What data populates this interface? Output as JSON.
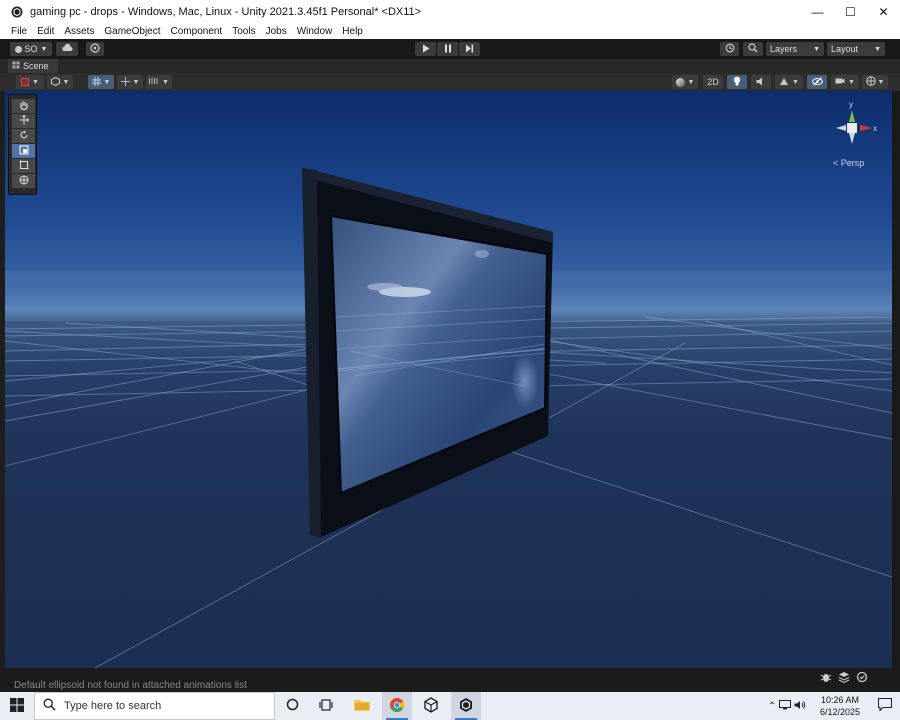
{
  "window": {
    "title": "gaming pc - drops - Windows, Mac, Linux - Unity 2021.3.45f1 Personal* <DX11>",
    "minimize": "—",
    "maximize": "☐",
    "close": "✕"
  },
  "menu": [
    "File",
    "Edit",
    "Assets",
    "GameObject",
    "Component",
    "Tools",
    "Jobs",
    "Window",
    "Help"
  ],
  "toolbar": {
    "account_label": "SO",
    "layers_label": "Layers",
    "layout_label": "Layout"
  },
  "scene_tab": {
    "label": "Scene"
  },
  "scene_toolbar": {
    "mode_2d_label": "2D"
  },
  "gizmo": {
    "y_label": "y",
    "x_label": "x",
    "projection_label": "Persp"
  },
  "status": {
    "message": "Default ellipsoid not found in attached animations list"
  },
  "taskbar": {
    "search_placeholder": "Type here to search",
    "time": "10:26 AM",
    "date": "6/12/2025"
  },
  "colors": {
    "sky_top": "#0d2d6e",
    "horizon": "#5a82b6",
    "ground": "#1c2f52",
    "frame": "#0b0f18",
    "gizmo_x": "#d23a2e",
    "gizmo_y": "#78c23a",
    "accent": "#5274a8"
  },
  "icons": {
    "app": "unity-logo-icon",
    "tools": [
      "hand-tool-icon",
      "move-tool-icon",
      "rotate-tool-icon",
      "scale-tool-icon",
      "rect-tool-icon",
      "transform-tool-icon"
    ]
  }
}
